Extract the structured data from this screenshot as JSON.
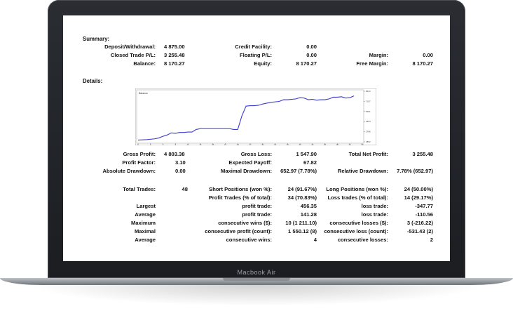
{
  "device_label": "Macbook Air",
  "summary": {
    "heading": "Summary:",
    "deposit_label": "Deposit/Withdrawal:",
    "deposit_value": "4 875.00",
    "credit_label": "Credit Facility:",
    "credit_value": "0.00",
    "closed_label": "Closed Trade P/L:",
    "closed_value": "3 255.48",
    "floating_label": "Floating P/L:",
    "floating_value": "0.00",
    "margin_label": "Margin:",
    "margin_value": "0.00",
    "balance_label": "Balance:",
    "balance_value": "8 170.27",
    "equity_label": "Equity:",
    "equity_value": "8 170.27",
    "free_margin_label": "Free Margin:",
    "free_margin_value": "8 170.27"
  },
  "details": {
    "heading": "Details:",
    "gross_profit_label": "Gross Profit:",
    "gross_profit_value": "4 803.38",
    "gross_loss_label": "Gross Loss:",
    "gross_loss_value": "1 547.90",
    "total_net_label": "Total Net Profit:",
    "total_net_value": "3 255.48",
    "profit_factor_label": "Profit Factor:",
    "profit_factor_value": "3.10",
    "expected_payoff_label": "Expected Payoff:",
    "expected_payoff_value": "67.82",
    "abs_dd_label": "Absolute Drawdown:",
    "abs_dd_value": "0.00",
    "max_dd_label": "Maximal Drawdown:",
    "max_dd_value": "652.97 (7.78%)",
    "rel_dd_label": "Relative Drawdown:",
    "rel_dd_value": "7.78% (652.97)",
    "total_trades_label": "Total Trades:",
    "total_trades_value": "48",
    "short_label": "Short Positions (won %):",
    "short_value": "24 (91.67%)",
    "long_label": "Long Positions (won %):",
    "long_value": "24 (50.00%)",
    "profit_trades_label": "Profit Trades (% of total):",
    "profit_trades_value": "34 (70.83%)",
    "loss_trades_label": "Loss trades (% of total):",
    "loss_trades_value": "14 (29.17%)",
    "rows": [
      {
        "a": "Largest",
        "b": "profit trade:",
        "c": "456.35",
        "d": "loss trade:",
        "e": "-347.77"
      },
      {
        "a": "Average",
        "b": "profit trade:",
        "c": "141.28",
        "d": "loss trade:",
        "e": "-110.56"
      },
      {
        "a": "Maximum",
        "b": "consecutive wins ($):",
        "c": "10 (1 211.10)",
        "d": "consecutive losses ($):",
        "e": "3 (-216.22)"
      },
      {
        "a": "Maximal",
        "b": "consecutive profit (count):",
        "c": "1 550.12 (8)",
        "d": "consecutive loss (count):",
        "e": "-531.43 (2)"
      },
      {
        "a": "Average",
        "b": "consecutive wins:",
        "c": "4",
        "d": "consecutive losses:",
        "e": "2"
      }
    ]
  },
  "chart_data": {
    "type": "line",
    "legend": "Balance",
    "line_color": "#3a3ad0",
    "x_ticks": [
      "0",
      "3",
      "6",
      "9",
      "12",
      "15",
      "18",
      "21",
      "24",
      "27",
      "30",
      "33",
      "36",
      "39",
      "42",
      "45",
      "48",
      "51",
      "54"
    ],
    "y_ticks": [
      "8523",
      "7197",
      "5961",
      "4824",
      "3786",
      "2862"
    ],
    "x": [
      0,
      2,
      4,
      5,
      6,
      7,
      8,
      9,
      10,
      11,
      12,
      13,
      14,
      15,
      16,
      17,
      18,
      19,
      20,
      21,
      22,
      23,
      24,
      25,
      26,
      27,
      28,
      29,
      30,
      31,
      32,
      33,
      34,
      35,
      36,
      37,
      38,
      39,
      40,
      41,
      42,
      43,
      44,
      45,
      46,
      47,
      48,
      49,
      50,
      51,
      52
    ],
    "y": [
      2900,
      2950,
      3050,
      3150,
      3350,
      3500,
      3750,
      3700,
      3800,
      3800,
      3850,
      3850,
      4150,
      4250,
      4250,
      4250,
      4250,
      4250,
      4250,
      4250,
      4250,
      4150,
      4150,
      5750,
      6900,
      6950,
      6950,
      7000,
      7150,
      7250,
      7350,
      7400,
      7450,
      7650,
      7650,
      7700,
      7750,
      7900,
      7850,
      7650,
      7700,
      7600,
      7650,
      7650,
      7750,
      7950,
      7950,
      8000,
      7850,
      7900,
      8100
    ],
    "ylim": [
      2700,
      8650
    ],
    "xlim": [
      0,
      54
    ]
  }
}
